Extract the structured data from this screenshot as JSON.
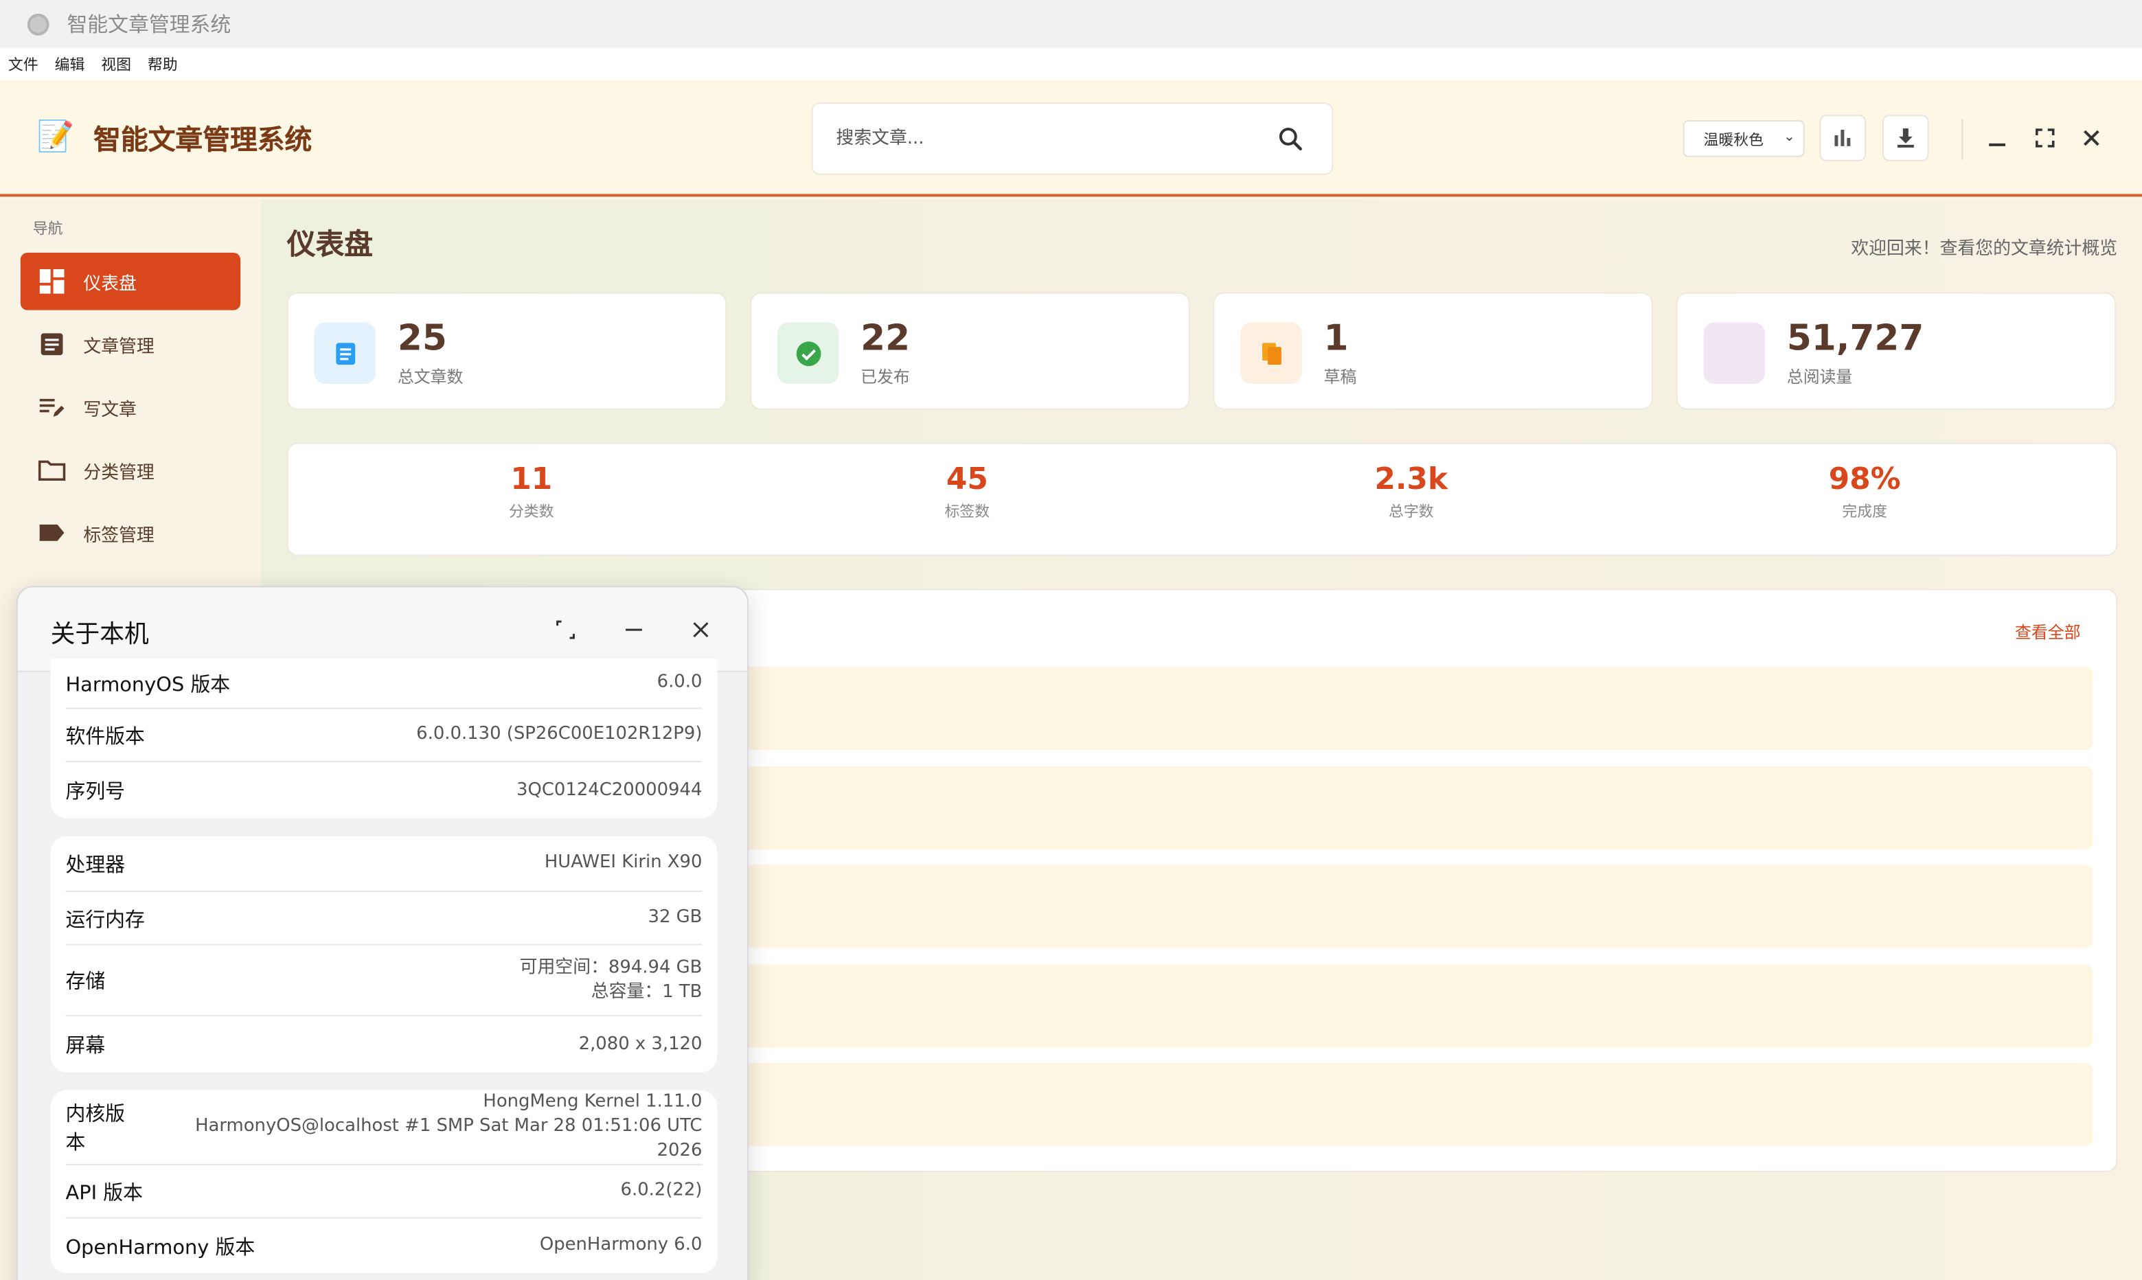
{
  "os": {
    "window_title": "智能文章管理系统"
  },
  "menubar": {
    "items": [
      "文件",
      "编辑",
      "视图",
      "帮助"
    ]
  },
  "header": {
    "brand_icon": "📝",
    "brand_title": "智能文章管理系统",
    "search_placeholder": "搜索文章...",
    "theme": "温暖秋色"
  },
  "sidebar": {
    "heading": "导航",
    "items": [
      {
        "label": "仪表盘",
        "icon": "dashboard-icon",
        "active": true
      },
      {
        "label": "文章管理",
        "icon": "article-icon"
      },
      {
        "label": "写文章",
        "icon": "write-icon"
      },
      {
        "label": "分类管理",
        "icon": "folder-icon"
      },
      {
        "label": "标签管理",
        "icon": "tag-icon"
      }
    ]
  },
  "dashboard": {
    "title": "仪表盘",
    "welcome": "欢迎回来！查看您的文章统计概览",
    "stats": [
      {
        "value": "25",
        "label": "总文章数",
        "icon": "document-icon",
        "color": "#2a9df4"
      },
      {
        "value": "22",
        "label": "已发布",
        "icon": "check-circle-icon",
        "color": "#3aa64a"
      },
      {
        "value": "1",
        "label": "草稿",
        "icon": "copy-icon",
        "color": "#f5a21b"
      },
      {
        "value": "51,727",
        "label": "总阅读量",
        "icon": "views-icon",
        "color": "#f3e6f4"
      }
    ],
    "metrics": [
      {
        "value": "11",
        "label": "分类数"
      },
      {
        "value": "45",
        "label": "标签数"
      },
      {
        "value": "2.3k",
        "label": "总字数"
      },
      {
        "value": "98%",
        "label": "完成度"
      }
    ],
    "view_all": "查看全部"
  },
  "about": {
    "title": "关于本机",
    "group1": [
      {
        "key": "HarmonyOS 版本",
        "value": "6.0.0"
      },
      {
        "key": "软件版本",
        "value": "6.0.0.130 (SP26C00E102R12P9)"
      },
      {
        "key": "序列号",
        "value": "3QC0124C20000944"
      }
    ],
    "group2": [
      {
        "key": "处理器",
        "value": "HUAWEI Kirin X90"
      },
      {
        "key": "运行内存",
        "value": "32 GB"
      },
      {
        "key": "存储",
        "value": "可用空间：894.94 GB",
        "value2": "总容量：1 TB"
      },
      {
        "key": "屏幕",
        "value": "2,080 x 3,120"
      }
    ],
    "group3": [
      {
        "key": "内核版本",
        "value": "HongMeng Kernel 1.11.0",
        "value2": "HarmonyOS@localhost #1 SMP Sat Mar 28 01:51:06 UTC 2026"
      },
      {
        "key": "API 版本",
        "value": "6.0.2(22)"
      },
      {
        "key": "OpenHarmony 版本",
        "value": "OpenHarmony 6.0"
      }
    ]
  }
}
